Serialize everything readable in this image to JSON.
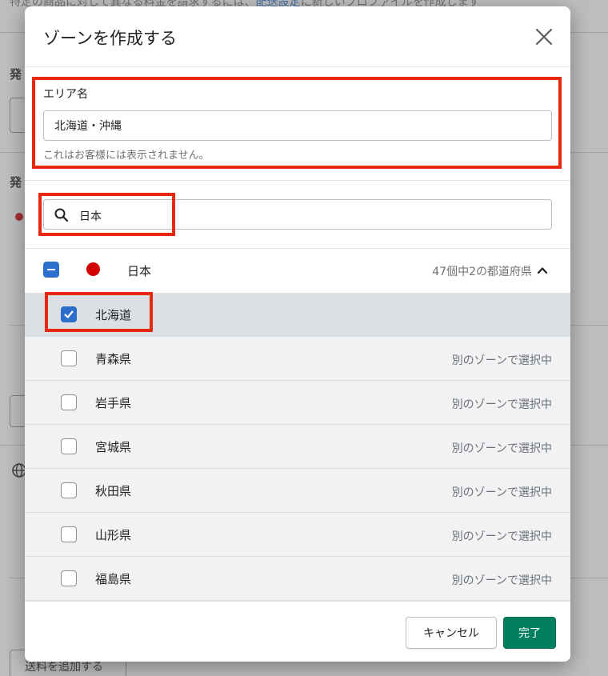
{
  "background": {
    "top_note_prefix": "特定の商品に対して異なる料金を請求するには、",
    "top_note_link": "配送設定",
    "top_note_suffix": "に新しいプロファイルを作成します",
    "section_label_1": "発",
    "section_label_2": "発",
    "add_rate_button": "送料を追加する"
  },
  "modal": {
    "title": "ゾーンを作成する",
    "area": {
      "label": "エリア名",
      "value": "北海道・沖縄",
      "help": "これはお客様には表示されません。"
    },
    "search": {
      "value": "日本"
    },
    "country": {
      "name": "日本",
      "count_text": "47個中2の都道府県",
      "flag_color": "#d20000"
    },
    "prefectures": [
      {
        "name": "北海道",
        "status": ""
      },
      {
        "name": "青森県",
        "status": "別のゾーンで選択中"
      },
      {
        "name": "岩手県",
        "status": "別のゾーンで選択中"
      },
      {
        "name": "宮城県",
        "status": "別のゾーンで選択中"
      },
      {
        "name": "秋田県",
        "status": "別のゾーンで選択中"
      },
      {
        "name": "山形県",
        "status": "別のゾーンで選択中"
      },
      {
        "name": "福島県",
        "status": "別のゾーンで選択中"
      }
    ],
    "footer": {
      "cancel_label": "キャンセル",
      "done_label": "完了"
    }
  },
  "colors": {
    "accent_blue": "#2c6ecb",
    "primary_green": "#008060",
    "annotation_red": "#e8270f"
  }
}
